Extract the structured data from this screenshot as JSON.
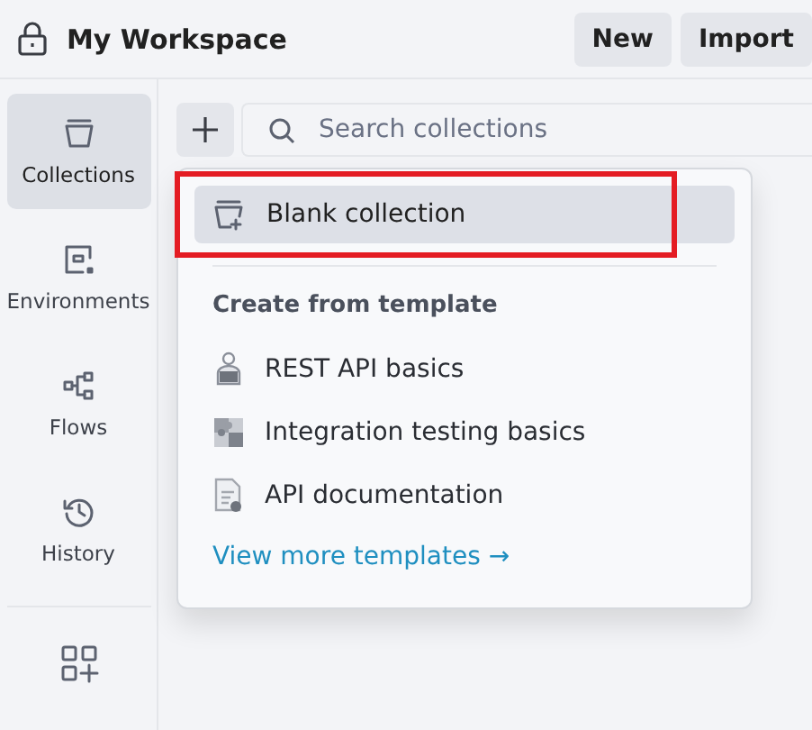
{
  "header": {
    "title": "My Workspace",
    "buttons": [
      "New",
      "Import"
    ]
  },
  "sidebar": {
    "items": [
      {
        "kind": "collections",
        "label": "Collections",
        "selected": true
      },
      {
        "kind": "environments",
        "label": "Environments",
        "selected": false
      },
      {
        "kind": "flows",
        "label": "Flows",
        "selected": false
      },
      {
        "kind": "history",
        "label": "History",
        "selected": false
      }
    ]
  },
  "search": {
    "placeholder": "Search collections"
  },
  "menu": {
    "blank_item": {
      "label": "Blank collection",
      "highlighted": true
    },
    "section_title": "Create from template",
    "templates": [
      {
        "kind": "rest",
        "label": "REST API basics"
      },
      {
        "kind": "integration",
        "label": "Integration testing basics"
      },
      {
        "kind": "docs",
        "label": "API documentation"
      }
    ],
    "link": "View more templates →"
  }
}
